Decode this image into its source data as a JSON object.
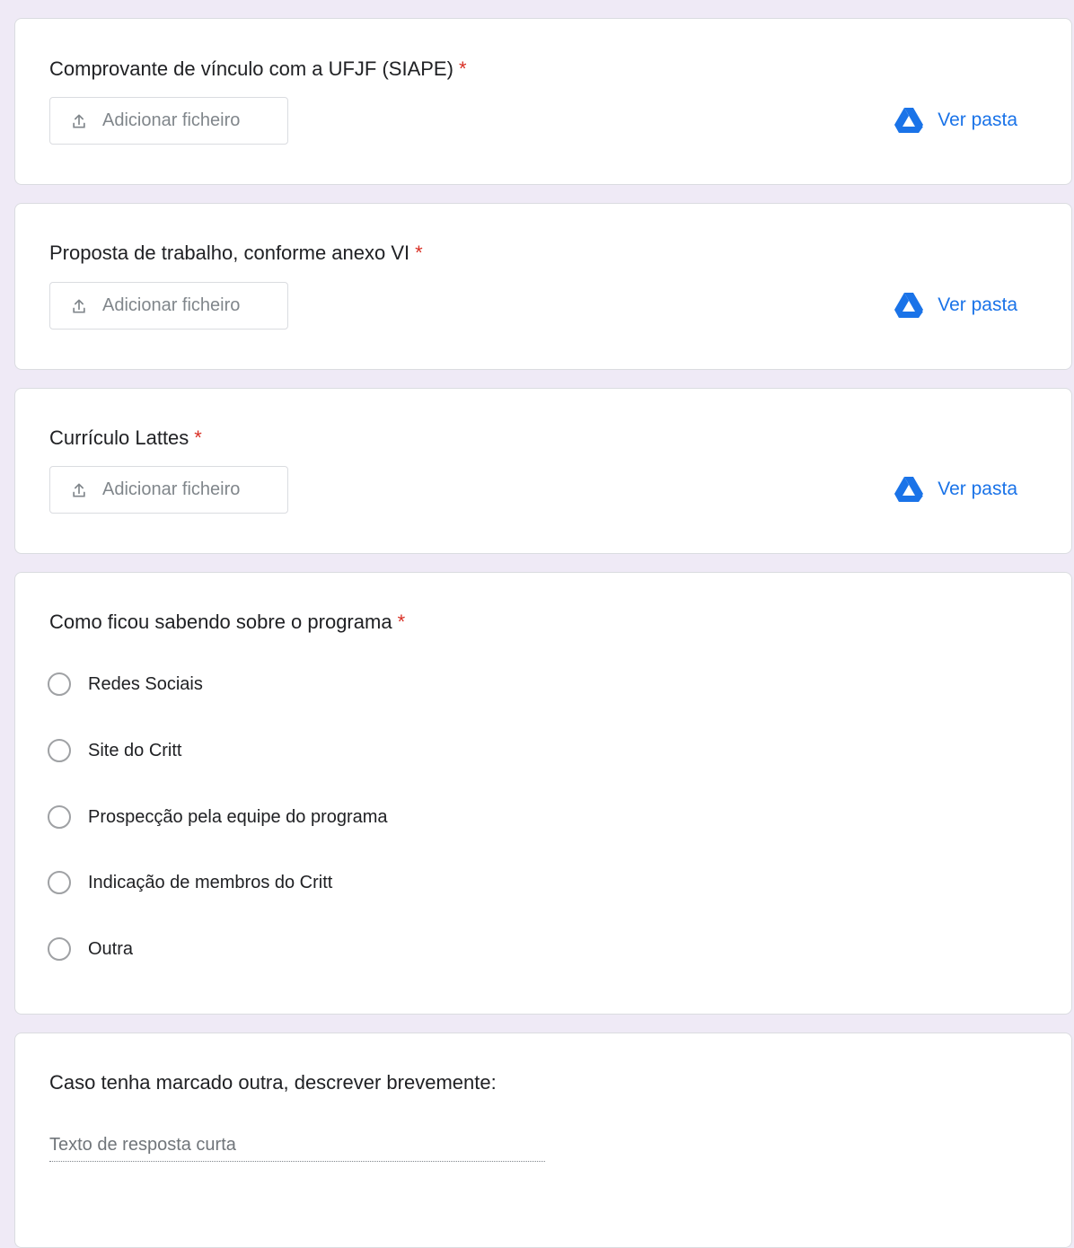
{
  "upload_questions": [
    {
      "title": "Comprovante de vínculo com a UFJF (SIAPE)",
      "required_mark": "*",
      "upload_label": "Adicionar ficheiro",
      "folder_label": "Ver pasta"
    },
    {
      "title": "Proposta de trabalho, conforme anexo VI",
      "required_mark": "*",
      "upload_label": "Adicionar ficheiro",
      "folder_label": "Ver pasta"
    },
    {
      "title": "Currículo Lattes",
      "required_mark": "*",
      "upload_label": "Adicionar ficheiro",
      "folder_label": "Ver pasta"
    }
  ],
  "radio_question": {
    "title": "Como ficou sabendo sobre o programa",
    "required_mark": "*",
    "options": [
      "Redes Sociais",
      "Site do Critt",
      "Prospecção pela equipe do programa",
      "Indicação de membros do Critt",
      "Outra"
    ],
    "selected": null
  },
  "text_question": {
    "title": "Caso tenha marcado outra, descrever brevemente:",
    "value": "",
    "placeholder": "Texto de resposta curta"
  },
  "colors": {
    "background": "#efeaf6",
    "card": "#ffffff",
    "accent_blue": "#1a73e8",
    "required_red": "#d93025",
    "muted_text": "#80868b"
  },
  "icons": {
    "upload": "upload-icon",
    "folder": "google-drive-icon"
  }
}
